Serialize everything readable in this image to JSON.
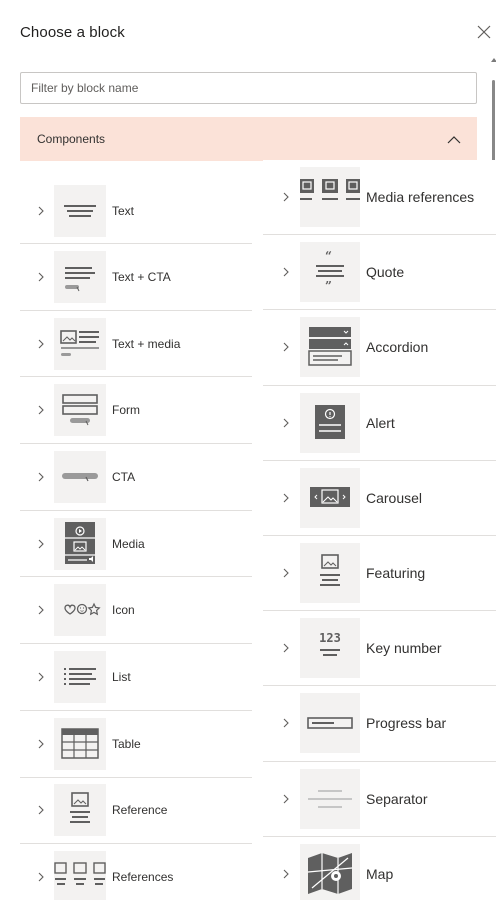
{
  "panel": {
    "title": "Choose a block",
    "close_icon": "close-icon"
  },
  "filter": {
    "placeholder": "Filter by block name",
    "value": ""
  },
  "section": {
    "label": "Components",
    "state": "expanded",
    "icon": "chevron-up-icon",
    "color": "#fbe2d8"
  },
  "blocks_left": [
    {
      "label": "Text",
      "icon": "text-block-icon"
    },
    {
      "label": "Text + CTA",
      "icon": "text-cta-block-icon"
    },
    {
      "label": "Text + media",
      "icon": "text-media-block-icon"
    },
    {
      "label": "Form",
      "icon": "form-block-icon"
    },
    {
      "label": "CTA",
      "icon": "cta-block-icon"
    },
    {
      "label": "Media",
      "icon": "media-block-icon"
    },
    {
      "label": "Icon",
      "icon": "icon-block-icon"
    },
    {
      "label": "List",
      "icon": "list-block-icon"
    },
    {
      "label": "Table",
      "icon": "table-block-icon"
    },
    {
      "label": "Reference",
      "icon": "reference-block-icon"
    },
    {
      "label": "References",
      "icon": "references-block-icon"
    }
  ],
  "blocks_right": [
    {
      "label": "Media references",
      "icon": "media-references-block-icon"
    },
    {
      "label": "Quote",
      "icon": "quote-block-icon"
    },
    {
      "label": "Accordion",
      "icon": "accordion-block-icon"
    },
    {
      "label": "Alert",
      "icon": "alert-block-icon"
    },
    {
      "label": "Carousel",
      "icon": "carousel-block-icon"
    },
    {
      "label": "Featuring",
      "icon": "featuring-block-icon"
    },
    {
      "label": "Key number",
      "icon": "key-number-block-icon",
      "icon_text": "123"
    },
    {
      "label": "Progress bar",
      "icon": "progress-bar-block-icon"
    },
    {
      "label": "Separator",
      "icon": "separator-block-icon"
    },
    {
      "label": "Map",
      "icon": "map-block-icon"
    }
  ],
  "colors": {
    "accent": "#fbe2d8",
    "thumb_bg": "#f3f2f1",
    "icon_dark": "#5f5f5f",
    "divider": "#e1dfdd"
  }
}
